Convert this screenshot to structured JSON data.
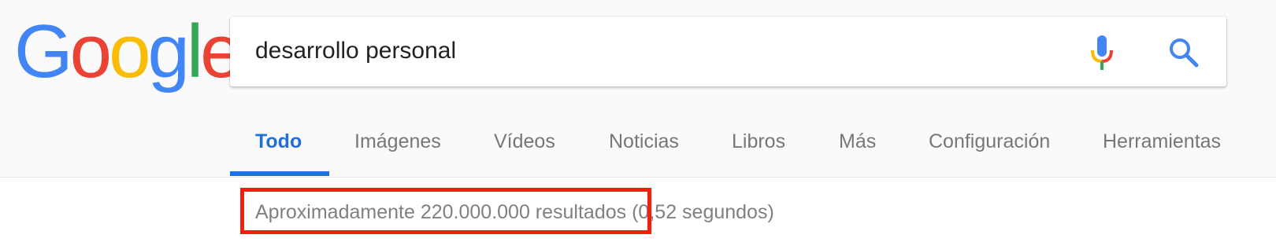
{
  "logo": {
    "letters": [
      "G",
      "o",
      "o",
      "g",
      "l",
      "e"
    ],
    "colors": [
      "#4285f4",
      "#ea4335",
      "#fbbc05",
      "#4285f4",
      "#34a853",
      "#ea4335"
    ]
  },
  "search": {
    "query": "desarrollo personal"
  },
  "icons": {
    "mic": "microphone-icon",
    "search": "magnifier-icon"
  },
  "tabs": [
    {
      "label": "Todo",
      "active": true
    },
    {
      "label": "Imágenes"
    },
    {
      "label": "Vídeos"
    },
    {
      "label": "Noticias"
    },
    {
      "label": "Libros"
    },
    {
      "label": "Más"
    },
    {
      "label": "Configuración"
    },
    {
      "label": "Herramientas"
    }
  ],
  "results": {
    "count_text": "Aproximadamente 220.000.000 resultados",
    "time_text": "(0,52 segundos)"
  },
  "highlight_color": "#f21e0f"
}
